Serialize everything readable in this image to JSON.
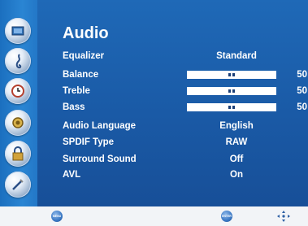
{
  "menu": {
    "title": "Audio",
    "items": [
      {
        "label": "Equalizer",
        "value": "Standard"
      },
      {
        "label": "Balance",
        "value": "50",
        "level": 0.5
      },
      {
        "label": "Treble",
        "value": "50",
        "level": 0.5
      },
      {
        "label": "Bass",
        "value": "50",
        "level": 0.5
      },
      {
        "label": "Audio Language",
        "value": "English"
      },
      {
        "label": "SPDIF Type",
        "value": "RAW"
      },
      {
        "label": "Surround Sound",
        "value": "Off"
      },
      {
        "label": "AVL",
        "value": "On"
      }
    ]
  },
  "sidebar": {
    "icons": [
      "picture-icon",
      "audio-note-icon",
      "clock-icon",
      "gear-icon",
      "lock-icon",
      "tools-icon"
    ]
  },
  "footer": {
    "menu_button": "MENU",
    "enter_button": "ENTER",
    "nav_icon": "direction-pad-icon"
  },
  "colors": {
    "panel": "#1f69b7",
    "sidebar": "#2a85d3",
    "footer": "#f2f4f7",
    "text": "#ffffff"
  }
}
